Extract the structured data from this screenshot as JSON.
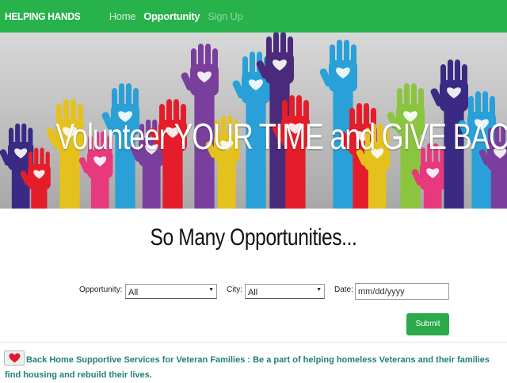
{
  "nav": {
    "brand": "HELPING HANDS",
    "links": [
      {
        "label": "Home"
      },
      {
        "label": "Opportunity"
      },
      {
        "label": "Sign Up"
      }
    ]
  },
  "hero": {
    "title": "Volunteer YOUR TIME and GIVE BACK !"
  },
  "section": {
    "title": "So Many Opportunities..."
  },
  "filters": {
    "opportunity_label": "Opportunity:",
    "opportunity_value": "All",
    "city_label": "City:",
    "city_value": "All",
    "date_label": "Date:",
    "date_placeholder": "mm/dd/yyyy",
    "submit_label": "Submit"
  },
  "listing": {
    "favorite_icon": "heart-icon",
    "text": "Back Home Supportive Services for Veteran Families : Be a part of helping homeless Veterans and their families find housing and rebuild their lives."
  },
  "colors": {
    "brand_green": "#27b24b",
    "button_green": "#2aaa4a",
    "link_teal": "#1f7f7a",
    "heart_red": "#e0192a"
  }
}
